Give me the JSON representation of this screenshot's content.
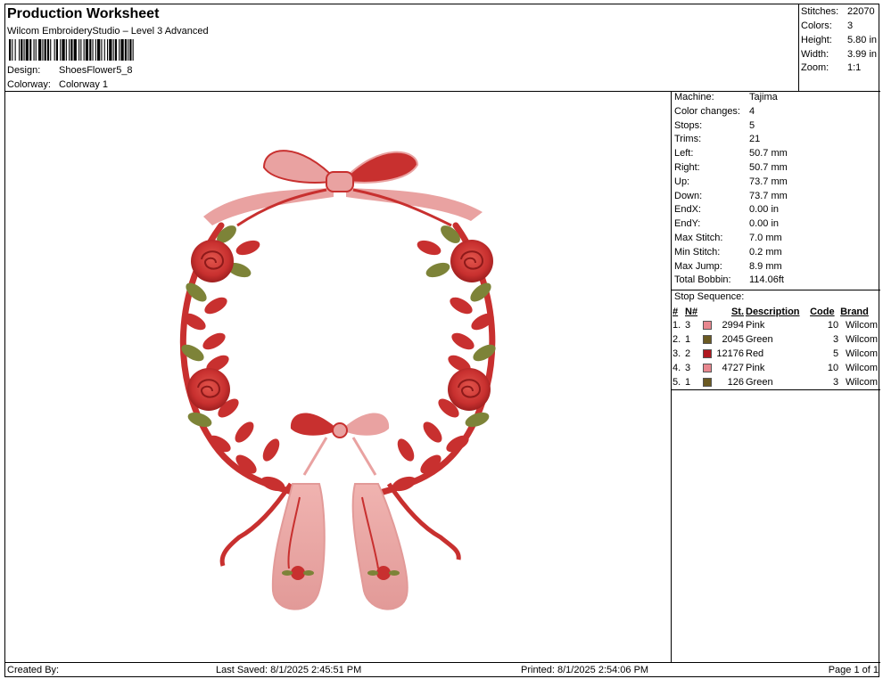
{
  "header": {
    "title": "Production Worksheet",
    "subtitle": "Wilcom EmbroideryStudio – Level 3 Advanced",
    "design_label": "Design:",
    "design_value": "ShoesFlower5_8",
    "colorway_label": "Colorway:",
    "colorway_value": "Colorway 1"
  },
  "summary": [
    {
      "label": "Stitches:",
      "value": "22070"
    },
    {
      "label": "Colors:",
      "value": "3"
    },
    {
      "label": "Height:",
      "value": "5.80 in"
    },
    {
      "label": "Width:",
      "value": "3.99 in"
    },
    {
      "label": "Zoom:",
      "value": "1:1"
    }
  ],
  "machine_info": [
    {
      "label": "Machine:",
      "value": "Tajima"
    },
    {
      "label": "Color changes:",
      "value": "4"
    },
    {
      "label": "Stops:",
      "value": "5"
    },
    {
      "label": "Trims:",
      "value": "21"
    },
    {
      "label": "Left:",
      "value": "50.7 mm"
    },
    {
      "label": "Right:",
      "value": "50.7 mm"
    },
    {
      "label": "Up:",
      "value": "73.7 mm"
    },
    {
      "label": "Down:",
      "value": "73.7 mm"
    },
    {
      "label": "EndX:",
      "value": "0.00 in"
    },
    {
      "label": "EndY:",
      "value": "0.00 in"
    },
    {
      "label": "Max Stitch:",
      "value": "7.0 mm"
    },
    {
      "label": "Min Stitch:",
      "value": "0.2 mm"
    },
    {
      "label": "Max Jump:",
      "value": "8.9 mm"
    },
    {
      "label": "Total Bobbin:",
      "value": "114.06ft"
    }
  ],
  "stop_sequence": {
    "heading": "Stop Sequence:",
    "columns": [
      "#",
      "N#",
      "St.",
      "Description",
      "Code",
      "Brand"
    ],
    "rows": [
      {
        "index": "1.",
        "n": "3",
        "color": "#e8878f",
        "st": "2994",
        "desc": "Pink",
        "code": "10",
        "brand": "Wilcom"
      },
      {
        "index": "2.",
        "n": "1",
        "color": "#6b5a22",
        "st": "2045",
        "desc": "Green",
        "code": "3",
        "brand": "Wilcom"
      },
      {
        "index": "3.",
        "n": "2",
        "color": "#b01820",
        "st": "12176",
        "desc": "Red",
        "code": "5",
        "brand": "Wilcom"
      },
      {
        "index": "4.",
        "n": "3",
        "color": "#e8878f",
        "st": "4727",
        "desc": "Pink",
        "code": "10",
        "brand": "Wilcom"
      },
      {
        "index": "5.",
        "n": "1",
        "color": "#6b5a22",
        "st": "126",
        "desc": "Green",
        "code": "3",
        "brand": "Wilcom"
      }
    ]
  },
  "footer": {
    "created_by": "Created By:",
    "last_saved": "Last Saved: 8/1/2025 2:45:51 PM",
    "printed": "Printed: 8/1/2025 2:54:06 PM",
    "page": "Page 1 of 1"
  },
  "colors": {
    "red": "#c8302f",
    "pink": "#e9a2a1",
    "green": "#7d8338"
  }
}
